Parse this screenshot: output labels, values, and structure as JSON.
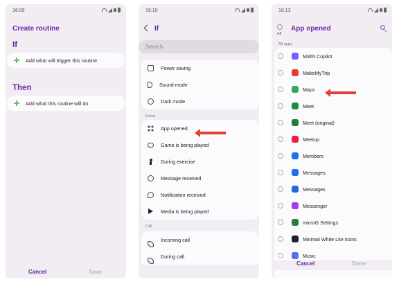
{
  "screen1": {
    "status_time": "16:09",
    "title": "Create routine",
    "if_heading": "If",
    "if_add": "Add what will trigger this routine",
    "then_heading": "Then",
    "then_add": "Add what this routine will do",
    "cancel": "Cancel",
    "save": "Save"
  },
  "screen2": {
    "status_time": "16:10",
    "title": "If",
    "search_placeholder": "Search",
    "group1": [
      "Power saving",
      "Sound mode",
      "Dark mode"
    ],
    "event_label": "Event",
    "events": [
      "App opened",
      "Game is being played",
      "During exercise",
      "Message received",
      "Notification received",
      "Media is being played"
    ],
    "call_label": "Call",
    "calls": [
      "Incoming call",
      "During call"
    ]
  },
  "screen3": {
    "status_time": "16:13",
    "all_label": "All",
    "title": "App opened",
    "section_label": "All apps",
    "apps": [
      {
        "name": "M365 Copilot",
        "color": "#7b5cff"
      },
      {
        "name": "MakeMyTrip",
        "color": "#e8392a"
      },
      {
        "name": "Maps",
        "color": "#34a853"
      },
      {
        "name": "Meet",
        "color": "#1e8e3e"
      },
      {
        "name": "Meet (original)",
        "color": "#188038"
      },
      {
        "name": "Meetup",
        "color": "#ed1c40"
      },
      {
        "name": "Members",
        "color": "#1a73e8"
      },
      {
        "name": "Messages",
        "color": "#1f6fe5"
      },
      {
        "name": "Messages",
        "color": "#2b66d8"
      },
      {
        "name": "Messenger",
        "color": "#a43cf0"
      },
      {
        "name": "microG Settings",
        "color": "#2e7d32"
      },
      {
        "name": "Minimal White Lite Icons",
        "color": "#222222"
      },
      {
        "name": "Music",
        "color": "#5a6fe0"
      }
    ],
    "cancel": "Cancel",
    "done": "Done"
  },
  "colors": {
    "accent": "#6a2aa8",
    "arrow": "#e0403a"
  }
}
